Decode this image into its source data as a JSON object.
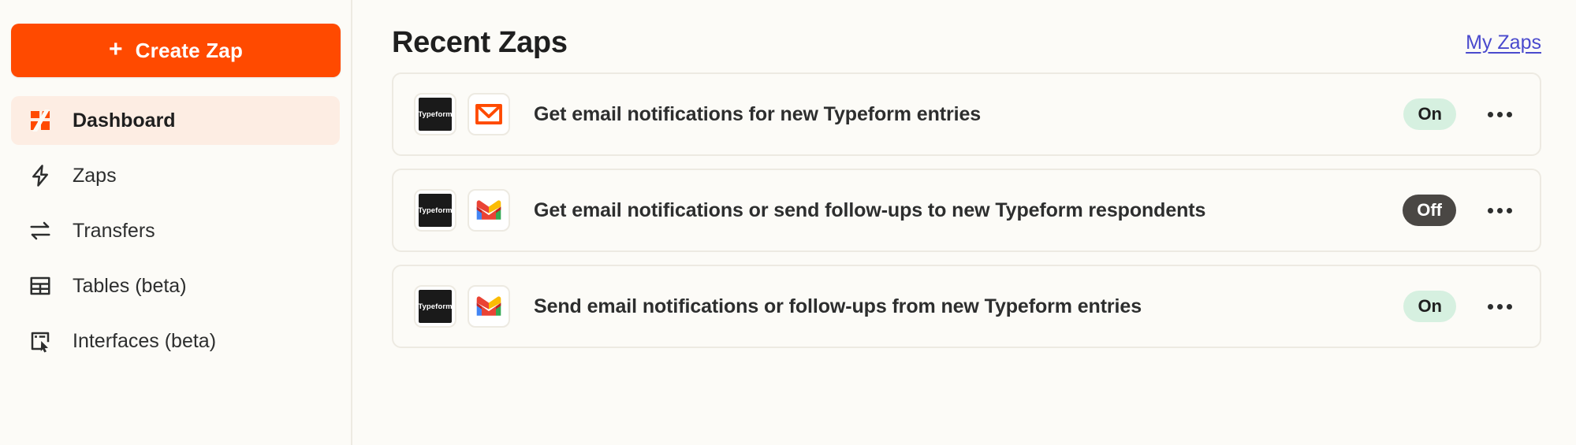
{
  "theme": {
    "background": "#FCFBF7",
    "accent": "#FF4A00",
    "link": "#4A4ACD",
    "border": "#EDEAE2",
    "text": "#2D2E2E",
    "badge_on_bg": "#D6F0E0",
    "badge_off_bg": "#4A4744"
  },
  "sidebar": {
    "create_button": {
      "label": "Create Zap",
      "icon": "plus-icon"
    },
    "items": [
      {
        "label": "Dashboard",
        "icon": "dashboard-icon",
        "active": true
      },
      {
        "label": "Zaps",
        "icon": "lightning-icon",
        "active": false
      },
      {
        "label": "Transfers",
        "icon": "transfer-icon",
        "active": false
      },
      {
        "label": "Tables (beta)",
        "icon": "table-icon",
        "active": false
      },
      {
        "label": "Interfaces (beta)",
        "icon": "interfaces-icon",
        "active": false
      }
    ]
  },
  "main": {
    "title": "Recent Zaps",
    "my_zaps_link": "My Zaps",
    "zaps": [
      {
        "title": "Get email notifications for new Typeform entries",
        "apps": [
          "typeform-icon",
          "email-envelope-icon"
        ],
        "status": "On",
        "menu_icon": "ellipsis-icon"
      },
      {
        "title": "Get email notifications or send follow-ups to new Typeform respondents",
        "apps": [
          "typeform-icon",
          "gmail-icon"
        ],
        "status": "Off",
        "menu_icon": "ellipsis-icon"
      },
      {
        "title": "Send email notifications or follow-ups from new Typeform entries",
        "apps": [
          "typeform-icon",
          "gmail-icon"
        ],
        "status": "On",
        "menu_icon": "ellipsis-icon"
      }
    ]
  },
  "icon_labels": {
    "typeform": "Typeform"
  }
}
